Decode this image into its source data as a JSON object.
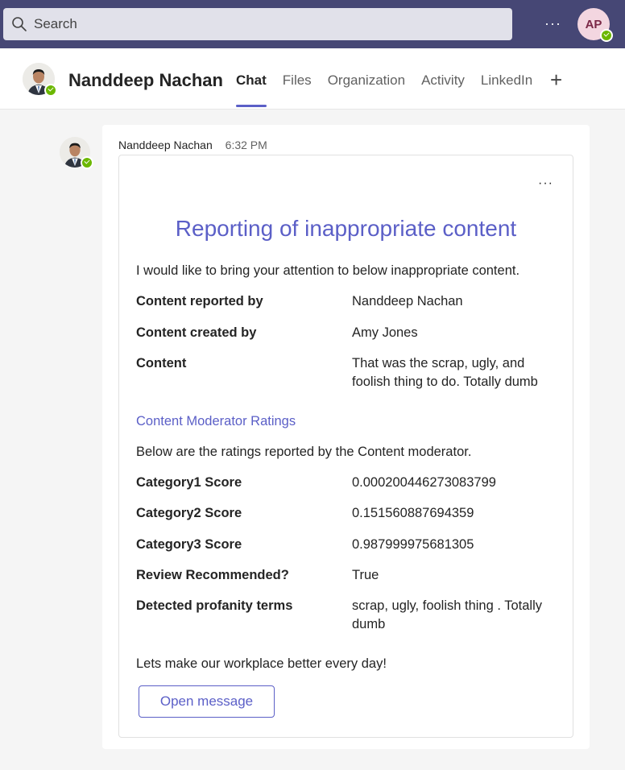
{
  "search": {
    "placeholder": "Search"
  },
  "topbar": {
    "more": "···",
    "user_initials": "AP"
  },
  "header": {
    "contact_name": "Nanddeep Nachan",
    "tabs": [
      {
        "label": "Chat",
        "active": true
      },
      {
        "label": "Files"
      },
      {
        "label": "Organization"
      },
      {
        "label": "Activity"
      },
      {
        "label": "LinkedIn"
      }
    ],
    "add_tab": "+"
  },
  "message": {
    "author": "Nanddeep Nachan",
    "time": "6:32 PM",
    "more": "···",
    "card": {
      "title": "Reporting of inappropriate content",
      "intro": "I would like to bring your attention to below inappropriate content.",
      "fields": [
        {
          "label": "Content reported by",
          "value": "Nanddeep Nachan"
        },
        {
          "label": "Content created by",
          "value": "Amy Jones"
        },
        {
          "label": "Content",
          "value": "That was the scrap, ugly, and foolish thing to do. Totally dumb"
        }
      ],
      "ratings_title": "Content Moderator Ratings",
      "ratings_intro": "Below are the ratings reported by the Content moderator.",
      "ratings": [
        {
          "label": "Category1 Score",
          "value": "0.000200446273083799"
        },
        {
          "label": "Category2 Score",
          "value": "0.151560887694359"
        },
        {
          "label": "Category3 Score",
          "value": "0.987999975681305"
        },
        {
          "label": "Review Recommended?",
          "value": "True"
        },
        {
          "label": "Detected profanity terms",
          "value": "scrap, ugly, foolish thing . Totally dumb"
        }
      ],
      "footer": "Lets make our workplace better every day!",
      "button": "Open message"
    }
  },
  "colors": {
    "brand": "#464775",
    "accent": "#5b5fc7",
    "presence": "#6bb700"
  }
}
